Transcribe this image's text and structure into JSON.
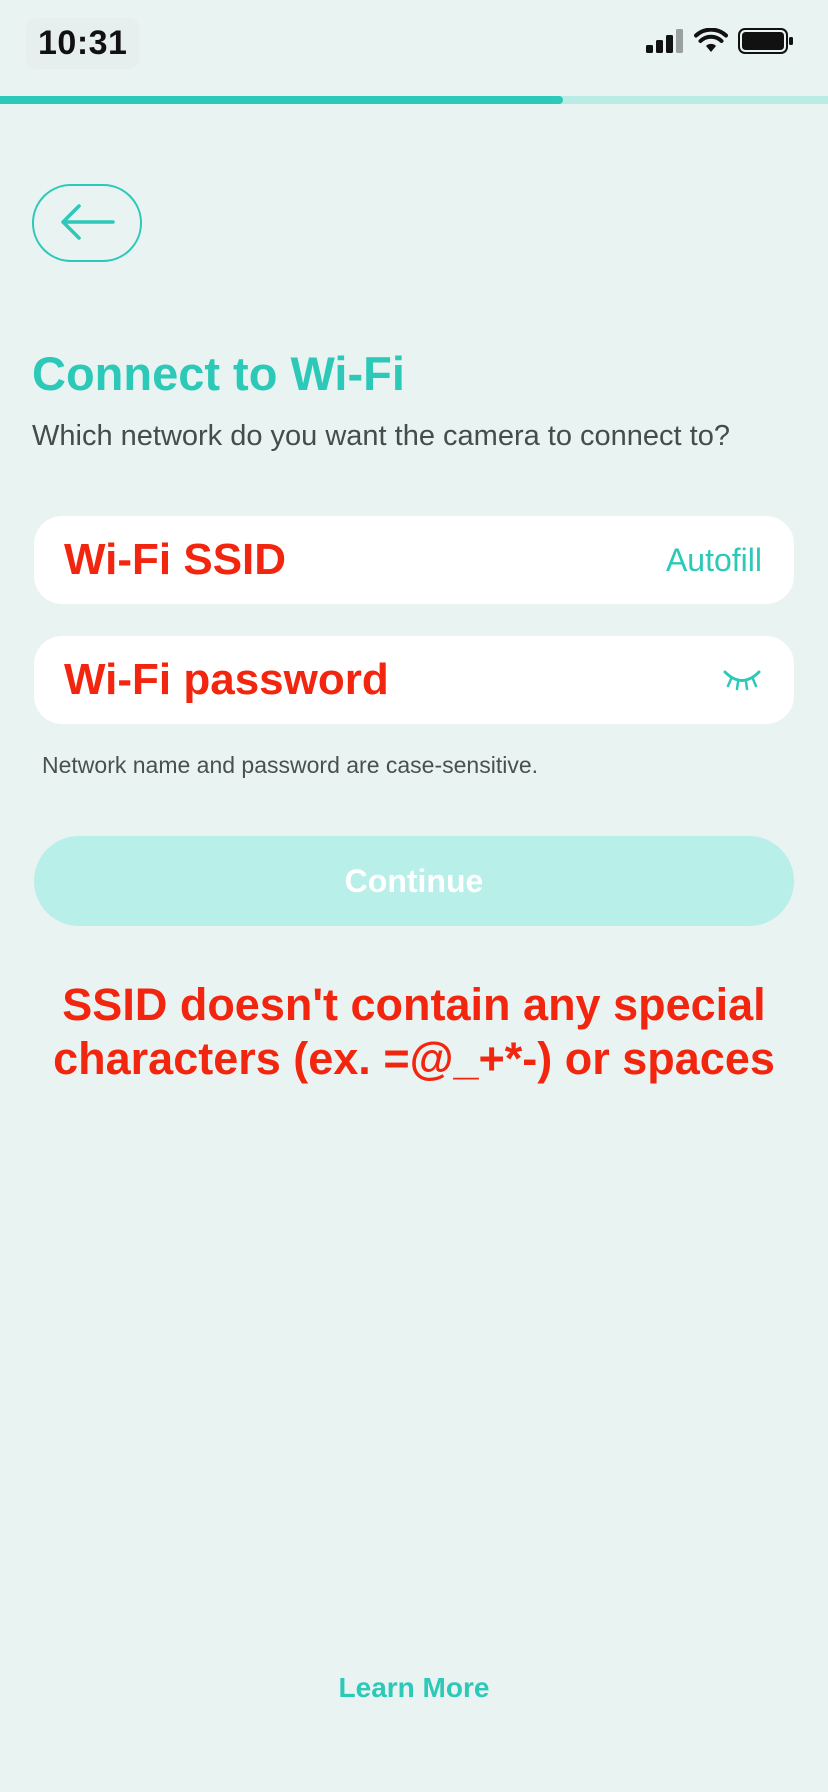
{
  "status_bar": {
    "time": "10:31",
    "icons": [
      "signal-icon",
      "wifi-icon",
      "battery-icon"
    ]
  },
  "progress": {
    "fraction": 0.68
  },
  "back_button": {
    "icon": "arrow-left-icon"
  },
  "header": {
    "title": "Connect to Wi-Fi",
    "subtitle": "Which network do you want the camera to connect to?"
  },
  "form": {
    "ssid": {
      "value": "Wi-Fi SSID",
      "autofill_label": "Autofill"
    },
    "password": {
      "value": "Wi-Fi password",
      "toggle_icon": "eye-closed-icon"
    },
    "hint": "Network name and password are case-sensitive."
  },
  "continue_button": {
    "label": "Continue",
    "disabled": true
  },
  "warning": {
    "line1": "SSID doesn't contain any special",
    "line2": "characters (ex. =@_+*-) or spaces"
  },
  "footer": {
    "learn_more": "Learn More"
  },
  "colors": {
    "accent": "#2cc8b8",
    "accent_light": "#b8efe8",
    "background": "#e9f3f1",
    "warning": "#f2250f"
  }
}
